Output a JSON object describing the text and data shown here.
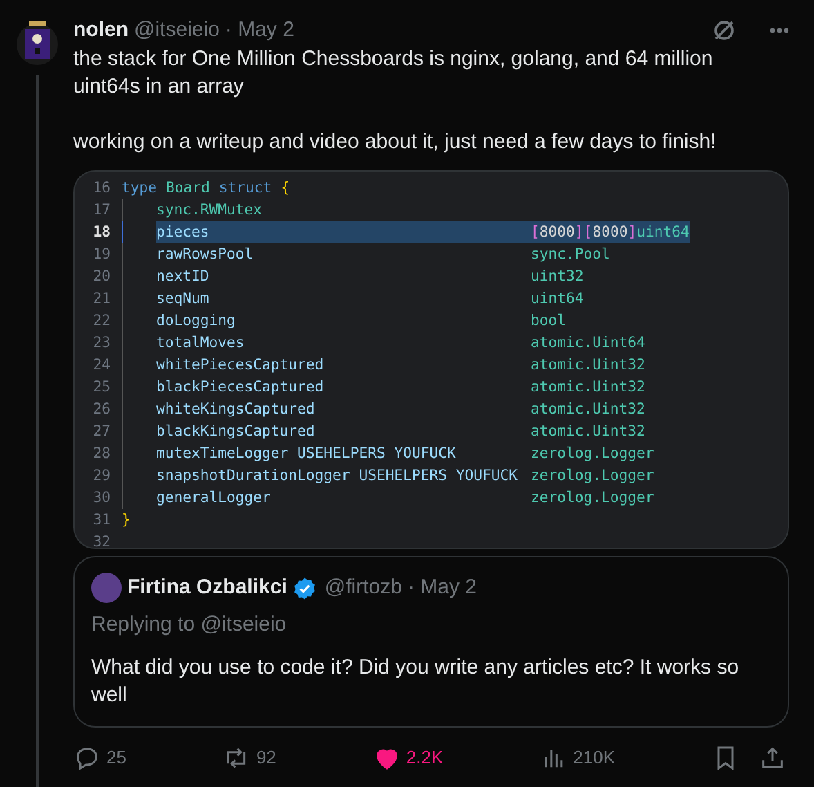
{
  "tweet": {
    "author": "nolen",
    "handle": "@itseieio",
    "date": "· May 2",
    "paragraphs": [
      "the stack for One Million Chessboards is nginx, golang, and 64 million uint64s in an array",
      "working on a writeup and video about it, just need a few days to finish!"
    ]
  },
  "code": {
    "lines": [
      {
        "number": "16",
        "kind": "header",
        "selected": false,
        "tokens": [
          {
            "text": "type",
            "kind": "keyword"
          },
          {
            "text": "Board",
            "kind": "type"
          },
          {
            "text": "struct",
            "kind": "keyword"
          },
          {
            "text": "{",
            "kind": "brace"
          }
        ]
      },
      {
        "number": "17",
        "kind": "field",
        "selected": false,
        "field": "sync.RWMutex"
      },
      {
        "number": "18",
        "kind": "field",
        "selected": true,
        "field": "pieces",
        "type": [
          {
            "text": "[",
            "kind": "bracket"
          },
          {
            "text": "8000",
            "kind": "number"
          },
          {
            "text": "]",
            "kind": "bracket"
          },
          {
            "text": "[",
            "kind": "bracket"
          },
          {
            "text": "8000",
            "kind": "number"
          },
          {
            "text": "]",
            "kind": "bracket"
          },
          {
            "text": "uint64",
            "kind": "type"
          }
        ]
      },
      {
        "number": "19",
        "kind": "field",
        "selected": false,
        "field": "rawRowsPool",
        "type": [
          {
            "text": "sync.Pool",
            "kind": "type"
          }
        ]
      },
      {
        "number": "20",
        "kind": "field",
        "selected": false,
        "field": "nextID",
        "type": [
          {
            "text": "uint32",
            "kind": "type"
          }
        ]
      },
      {
        "number": "21",
        "kind": "field",
        "selected": false,
        "field": "seqNum",
        "type": [
          {
            "text": "uint64",
            "kind": "type"
          }
        ]
      },
      {
        "number": "22",
        "kind": "field",
        "selected": false,
        "field": "doLogging",
        "type": [
          {
            "text": "bool",
            "kind": "type"
          }
        ]
      },
      {
        "number": "23",
        "kind": "field",
        "selected": false,
        "field": "totalMoves",
        "type": [
          {
            "text": "atomic.Uint64",
            "kind": "type"
          }
        ]
      },
      {
        "number": "24",
        "kind": "field",
        "selected": false,
        "field": "whitePiecesCaptured",
        "type": [
          {
            "text": "atomic.Uint32",
            "kind": "type"
          }
        ]
      },
      {
        "number": "25",
        "kind": "field",
        "selected": false,
        "field": "blackPiecesCaptured",
        "type": [
          {
            "text": "atomic.Uint32",
            "kind": "type"
          }
        ]
      },
      {
        "number": "26",
        "kind": "field",
        "selected": false,
        "field": "whiteKingsCaptured",
        "type": [
          {
            "text": "atomic.Uint32",
            "kind": "type"
          }
        ]
      },
      {
        "number": "27",
        "kind": "field",
        "selected": false,
        "field": "blackKingsCaptured",
        "type": [
          {
            "text": "atomic.Uint32",
            "kind": "type"
          }
        ]
      },
      {
        "number": "28",
        "kind": "field",
        "selected": false,
        "field": "mutexTimeLogger_USEHELPERS_YOUFUCK",
        "type": [
          {
            "text": "zerolog.Logger",
            "kind": "type"
          }
        ]
      },
      {
        "number": "29",
        "kind": "field",
        "selected": false,
        "field": "snapshotDurationLogger_USEHELPERS_YOUFUCK",
        "type": [
          {
            "text": "zerolog.Logger",
            "kind": "type"
          }
        ]
      },
      {
        "number": "30",
        "kind": "field",
        "selected": false,
        "field": "generalLogger",
        "type": [
          {
            "text": "zerolog.Logger",
            "kind": "type"
          }
        ]
      },
      {
        "number": "31",
        "kind": "header",
        "selected": false,
        "tokens": [
          {
            "text": "}",
            "kind": "brace"
          }
        ]
      },
      {
        "number": "32",
        "kind": "header",
        "selected": false
      }
    ]
  },
  "quote": {
    "author": "Firtina Ozbalikci",
    "verified": true,
    "handle": "@firtozb",
    "date": "· May 2",
    "replying_to": "Replying to @itseieio",
    "text": "What did you use to code it? Did you write any articles etc? It works so well"
  },
  "actions": [
    {
      "kind": "reply",
      "count": "25",
      "active": false
    },
    {
      "kind": "repost",
      "count": "92",
      "active": false
    },
    {
      "kind": "like",
      "count": "2.2K",
      "active": true
    },
    {
      "kind": "views",
      "count": "210K",
      "active": false
    },
    {
      "kind": "bookmark",
      "active": false
    },
    {
      "kind": "share",
      "active": false
    }
  ]
}
